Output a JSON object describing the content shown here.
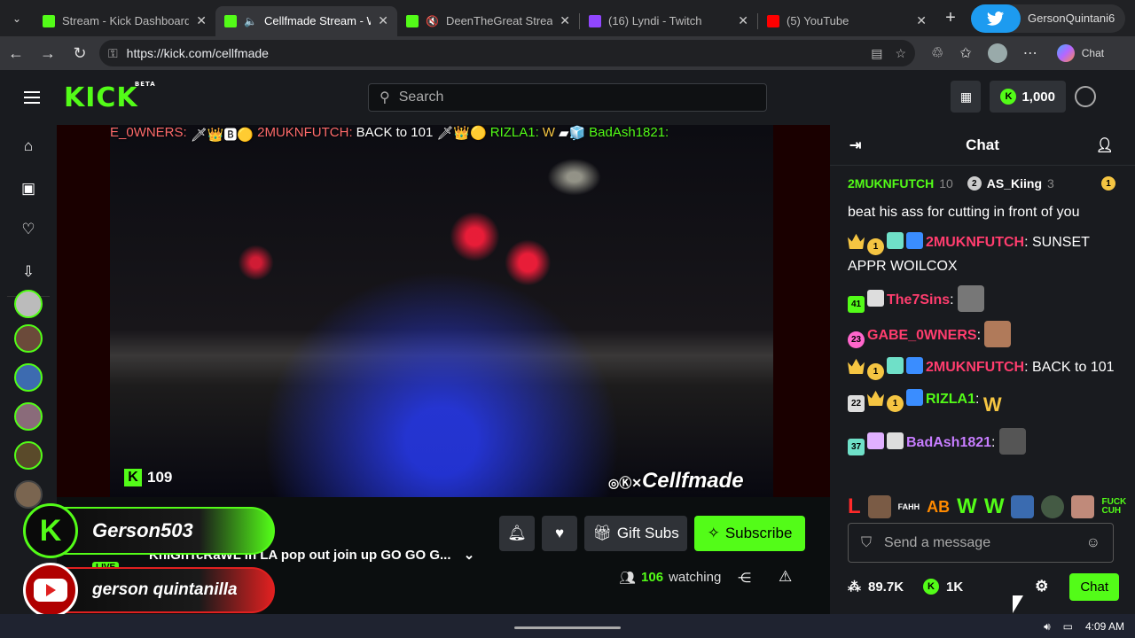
{
  "browser": {
    "tabs": [
      {
        "title": "Stream - Kick Dashboard",
        "fav_color": "#53fc18"
      },
      {
        "title": "Cellfmade Stream - Wa",
        "fav_color": "#53fc18",
        "active": true
      },
      {
        "title": "DeenTheGreat Stream -",
        "fav_color": "#53fc18"
      },
      {
        "title": "(16) Lyndi - Twitch",
        "fav_color": "#9146ff"
      },
      {
        "title": "(5) YouTube",
        "fav_color": "#ff0000"
      }
    ],
    "profile_name": "GersonQuintani6",
    "url": "https://kick.com/cellfmade",
    "copilot_label": "Chat"
  },
  "kick": {
    "logo": "KICK",
    "logo_badge": "BETA",
    "search_placeholder": "Search",
    "coins": "1,000"
  },
  "overlay_chat": {
    "seg1": "E_0WNERS:",
    "seg2_user": "2MUKNFUTCH:",
    "seg2_text": "BACK to 101",
    "seg3_user": "RIZLA1:",
    "seg3_text": "W",
    "seg4_user": "BadAsh1821:"
  },
  "video": {
    "viewer_badge": "109",
    "watermark": "Cellfmade"
  },
  "below": {
    "gift_subs": "Gift Subs",
    "subscribe": "Subscribe",
    "stream_title": "KnIGhTcRaWL in LA pop out join up GO GO G...",
    "watching_count": "106",
    "watching_label": "watching"
  },
  "overlays": {
    "kick_name": "Gerson503",
    "yt_name": "gerson quintanilla",
    "live": "LIVE"
  },
  "chat": {
    "title": "Chat",
    "gifter1": "2MUKNFUTCH",
    "gifter1_count": "10",
    "gifter2_rank": "2",
    "gifter2": "AS_Kiing",
    "gifter2_count": "3",
    "gifter3_rank": "1",
    "messages": [
      {
        "user": "",
        "text": "beat his ass for cutting in front of you",
        "color": ""
      },
      {
        "user": "2MUKNFUTCH",
        "text": " SUNSET APPR WOILCOX"
      },
      {
        "badge": "41",
        "user": "The7Sins",
        "text": ""
      },
      {
        "badge": "23",
        "user": "GABE_0WNERS",
        "text": ""
      },
      {
        "user": "2MUKNFUTCH",
        "text": " BACK to 101"
      },
      {
        "badge": "22",
        "user": "RIZLA1",
        "text": "W"
      },
      {
        "badge": "37",
        "user": "BadAsh1821",
        "text": ""
      }
    ],
    "emote_strip": {
      "l": "L",
      "fahh": "FAHH",
      "ab": "AB",
      "w1": "W",
      "w2": "W",
      "fc1": "FUCK",
      "fc2": "CUH"
    },
    "input_placeholder": "Send a message",
    "stat1": "89.7K",
    "stat2": "1K",
    "send": "Chat"
  },
  "taskbar": {
    "time": "4:09 AM"
  }
}
